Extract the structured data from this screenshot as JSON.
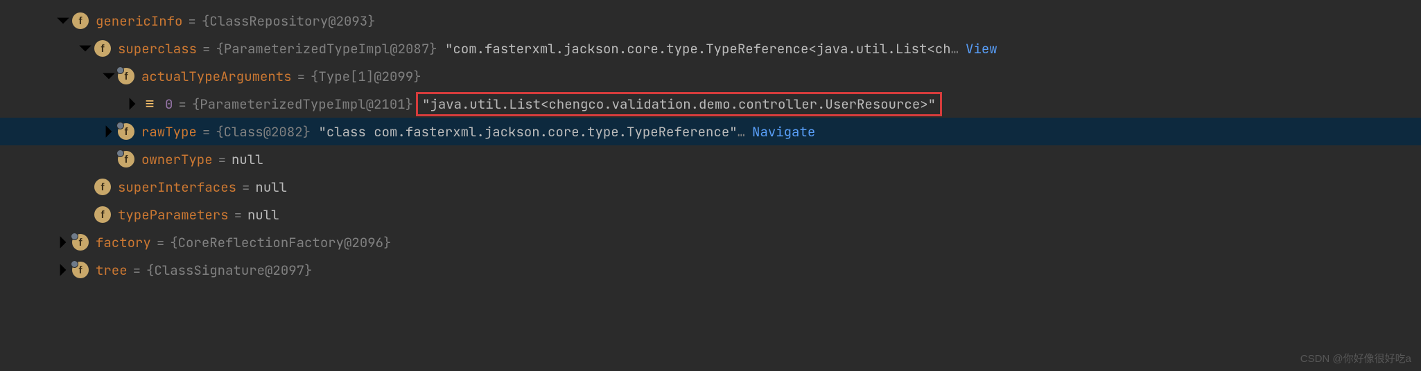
{
  "rows": {
    "genericInfo": {
      "name": "genericInfo",
      "eq": "=",
      "value": "{ClassRepository@2093}"
    },
    "superclass": {
      "name": "superclass",
      "eq": "=",
      "value_gray": "{ParameterizedTypeImpl@2087}",
      "value_str": "\"com.fasterxml.jackson.core.type.TypeReference<java.util.List<ch",
      "ellipsis": "…",
      "link": "View"
    },
    "actualTypeArguments": {
      "name": "actualTypeArguments",
      "eq": "=",
      "value": "{Type[1]@2099}"
    },
    "elem0": {
      "name": "0",
      "eq": "=",
      "value_gray": "{ParameterizedTypeImpl@2101}",
      "value_str": "\"java.util.List<chengco.validation.demo.controller.UserResource>\""
    },
    "rawType": {
      "name": "rawType",
      "eq": "=",
      "value_gray": "{Class@2082}",
      "value_str": "\"class com.fasterxml.jackson.core.type.TypeReference\"",
      "ellipsis": "…",
      "link": "Navigate"
    },
    "ownerType": {
      "name": "ownerType",
      "eq": "=",
      "value": "null"
    },
    "superInterfaces": {
      "name": "superInterfaces",
      "eq": "=",
      "value": "null"
    },
    "typeParameters": {
      "name": "typeParameters",
      "eq": "=",
      "value": "null"
    },
    "factory": {
      "name": "factory",
      "eq": "=",
      "value": "{CoreReflectionFactory@2096}"
    },
    "tree": {
      "name": "tree",
      "eq": "=",
      "value": "{ClassSignature@2097}"
    }
  },
  "badge_f": "f",
  "badge_arr": "≡",
  "watermark": "CSDN @你好像很好吃a"
}
